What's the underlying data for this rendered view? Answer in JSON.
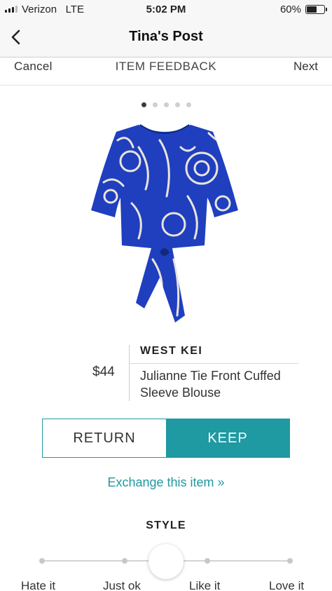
{
  "status_bar": {
    "carrier": "Verizon",
    "network": "LTE",
    "time": "5:02 PM",
    "battery_percent": "60%",
    "battery_level": 0.6
  },
  "nav": {
    "title": "Tina's Post",
    "back_icon": "chevron-left-icon"
  },
  "feedback_header": {
    "cancel": "Cancel",
    "title": "ITEM FEEDBACK",
    "next": "Next"
  },
  "pager": {
    "count": 5,
    "active_index": 0
  },
  "product": {
    "brand": "WEST KEI",
    "name": "Julianne Tie Front Cuffed Sleeve Blouse",
    "price": "$44",
    "image_colors": {
      "body": "#1f3fbf",
      "flowers": "#e9e4dc"
    }
  },
  "decision": {
    "return_label": "RETURN",
    "keep_label": "KEEP",
    "selected": "keep",
    "accent_color": "#1f99a2"
  },
  "exchange_link": "Exchange this item »",
  "style": {
    "heading": "STYLE",
    "options": [
      "Hate it",
      "Just ok",
      "",
      "Like it",
      "Love it"
    ],
    "selected_index": 2
  }
}
